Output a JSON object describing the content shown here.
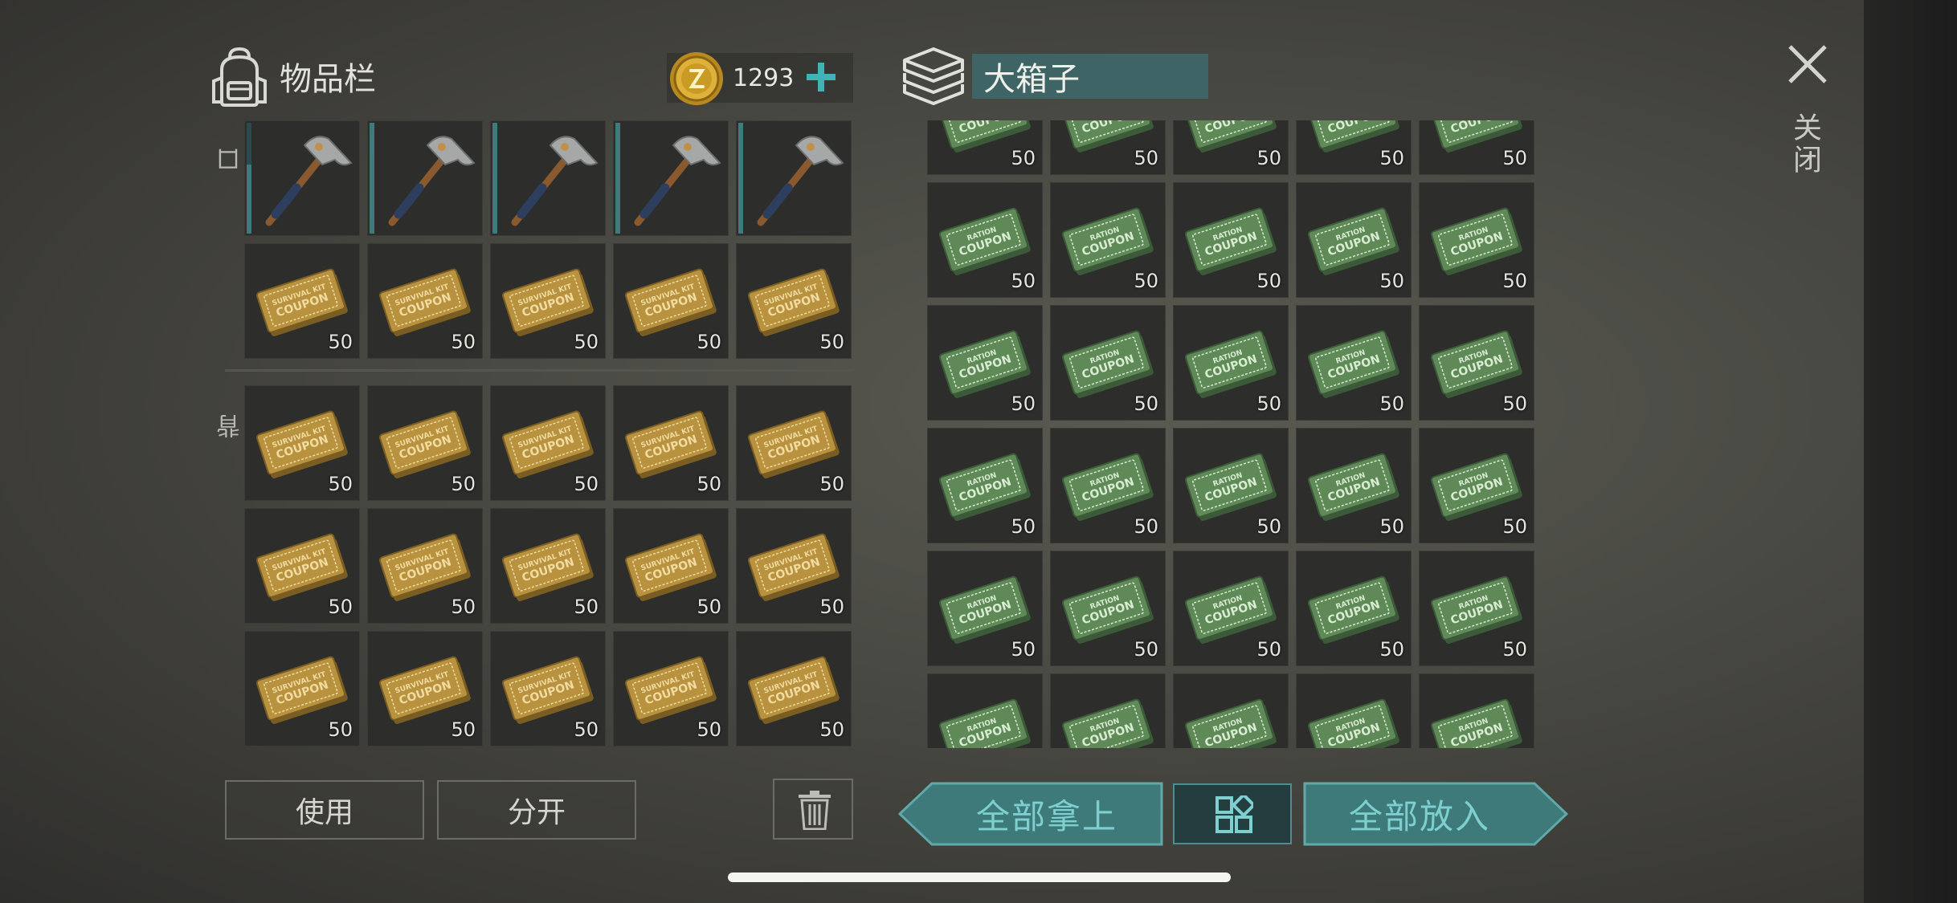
{
  "inventory": {
    "title": "物品栏",
    "coins": "1293",
    "pocket_label": "口袋",
    "backpack_label": "背包",
    "pocket": {
      "axes": [
        {
          "durability": 0.62
        },
        {
          "durability": 1.0
        },
        {
          "durability": 1.0
        },
        {
          "durability": 1.0
        },
        {
          "durability": 1.0
        }
      ],
      "coupons": [
        "50",
        "50",
        "50",
        "50",
        "50"
      ]
    },
    "backpack": {
      "rows": [
        [
          "50",
          "50",
          "50",
          "50",
          "50"
        ],
        [
          "50",
          "50",
          "50",
          "50",
          "50"
        ],
        [
          "50",
          "50",
          "50",
          "50",
          "50"
        ]
      ]
    },
    "coupon_text": [
      "SURVIVAL KIT",
      "COUPON"
    ],
    "buttons": {
      "use": "使用",
      "split": "分开"
    }
  },
  "chest": {
    "title": "大箱子",
    "coupon_text": [
      "RATION",
      "COUPON"
    ],
    "rows": [
      [
        "50",
        "50",
        "50",
        "50",
        "50"
      ],
      [
        "50",
        "50",
        "50",
        "50",
        "50"
      ],
      [
        "50",
        "50",
        "50",
        "50",
        "50"
      ],
      [
        "50",
        "50",
        "50",
        "50",
        "50"
      ],
      [
        "50",
        "50",
        "50",
        "50",
        "50"
      ],
      [
        "",
        "",
        "",
        "",
        "",
        ""
      ]
    ],
    "buttons": {
      "take_all": "全部拿上",
      "put_all": "全部放入"
    }
  },
  "close_label": "关闭",
  "colors": {
    "teal": "#4e9a9c",
    "teal_text": "#7ecfd0",
    "chest_title_bg": "#3f6466",
    "gold_coupon": "#b8923f",
    "green_coupon": "#5f8a58"
  }
}
